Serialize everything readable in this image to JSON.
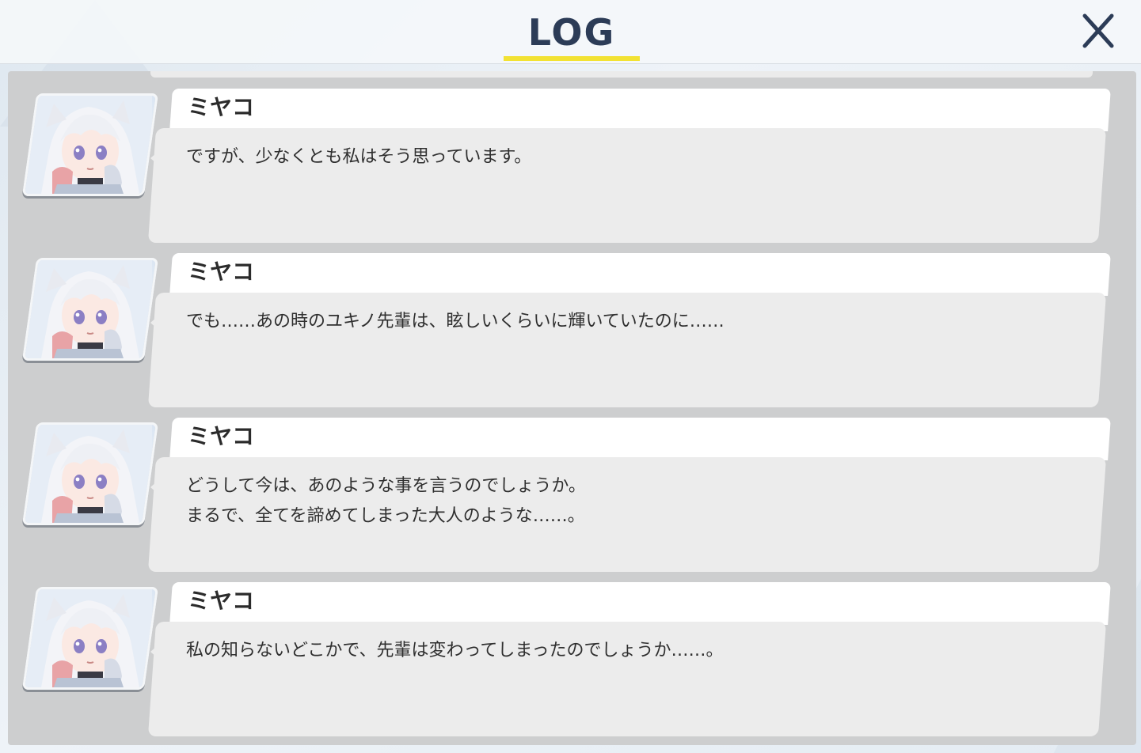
{
  "header": {
    "title": "LOG",
    "accent_color": "#f2e233",
    "close_icon": "close-icon"
  },
  "log": {
    "entries": [
      {
        "speaker": "ミヤコ",
        "lines": [
          "ですが、少なくとも私はそう思っています。"
        ]
      },
      {
        "speaker": "ミヤコ",
        "lines": [
          "でも……あの時のユキノ先輩は、眩しいくらいに輝いていたのに……"
        ]
      },
      {
        "speaker": "ミヤコ",
        "lines": [
          "どうして今は、あのような事を言うのでしょうか。",
          "まるで、全てを諦めてしまった大人のような……。"
        ]
      },
      {
        "speaker": "ミヤコ",
        "lines": [
          "私の知らないどこかで、先輩は変わってしまったのでしょうか……。"
        ]
      }
    ]
  }
}
